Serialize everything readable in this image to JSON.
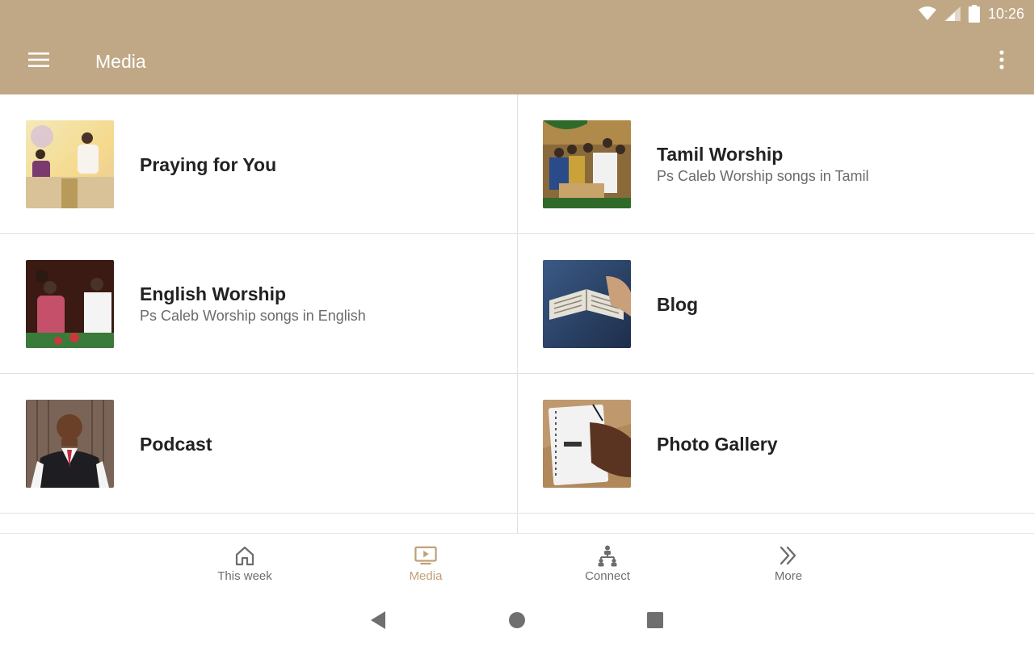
{
  "status_bar": {
    "time": "10:26"
  },
  "app_bar": {
    "title": "Media",
    "menu_icon": "hamburger-menu-icon",
    "overflow_icon": "more-vert-icon"
  },
  "tiles": [
    {
      "title": "Praying for You",
      "subtitle": ""
    },
    {
      "title": "Tamil Worship",
      "subtitle": "Ps Caleb Worship songs in Tamil"
    },
    {
      "title": "English Worship",
      "subtitle": "Ps Caleb Worship songs in English"
    },
    {
      "title": "Blog",
      "subtitle": ""
    },
    {
      "title": "Podcast",
      "subtitle": ""
    },
    {
      "title": "Photo Gallery",
      "subtitle": ""
    }
  ],
  "bottom_nav": {
    "items": [
      {
        "label": "This week",
        "icon": "home-icon",
        "active": false
      },
      {
        "label": "Media",
        "icon": "video-play-icon",
        "active": true
      },
      {
        "label": "Connect",
        "icon": "network-people-icon",
        "active": false
      },
      {
        "label": "More",
        "icon": "double-chevron-right-icon",
        "active": false
      }
    ]
  },
  "colors": {
    "app_bar": "#c0a886",
    "accent": "#c0a078",
    "divider": "#e0e0e0",
    "title_text": "#222222",
    "subtitle_text": "#6b6b6b"
  }
}
